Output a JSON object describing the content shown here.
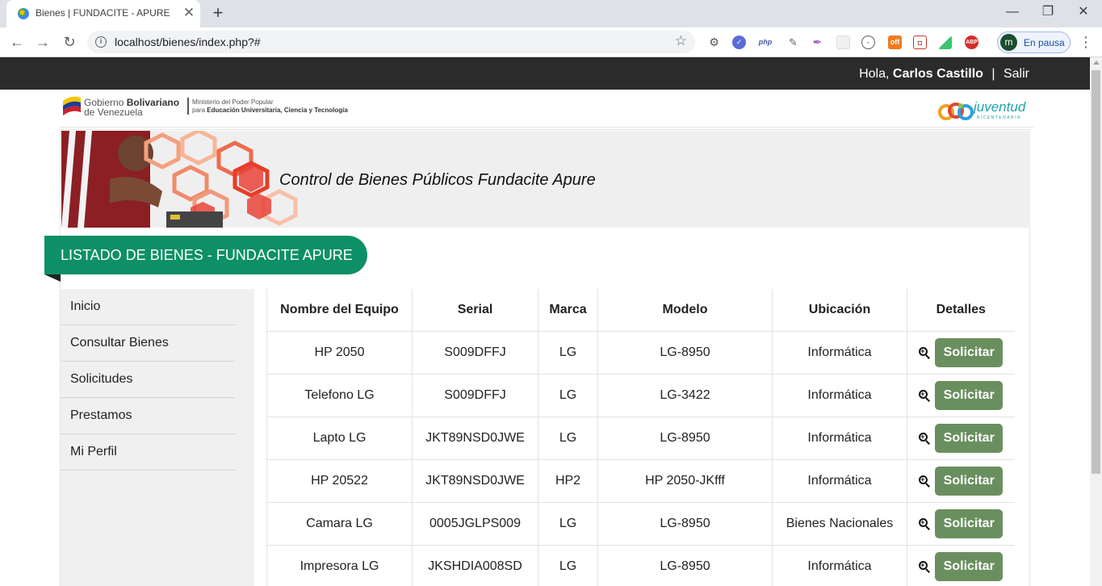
{
  "browser": {
    "tab_title": "Bienes | FUNDACITE - APURE",
    "url": "localhost/bienes/index.php?#",
    "profile_initial": "m",
    "profile_status": "En pausa",
    "extensions": [
      "php",
      "off",
      "ABP"
    ]
  },
  "topbar": {
    "greeting_prefix": "Hola,",
    "user_name": "Carlos Castillo",
    "separator": "|",
    "logout": "Salir"
  },
  "header": {
    "gob_line1_a": "Gobierno",
    "gob_line1_b": "Bolivariano",
    "gob_line2": "de Venezuela",
    "ministry_line1": "Ministerio del Poder Popular",
    "ministry_line2_a": "para",
    "ministry_line2_b": "Educación Universitaria, Ciencia y Tecnología",
    "juventud_logo": "juventud",
    "juventud_sub": "BICENTENARIA"
  },
  "banner": {
    "title": "Control de Bienes Públicos Fundacite Apure"
  },
  "section": {
    "title": "LISTADO DE BIENES - FUNDACITE APURE"
  },
  "sidebar": {
    "items": [
      {
        "label": "Inicio"
      },
      {
        "label": "Consultar Bienes"
      },
      {
        "label": "Solicitudes"
      },
      {
        "label": "Prestamos"
      },
      {
        "label": "Mi Perfil"
      }
    ]
  },
  "table": {
    "headers": [
      "Nombre del Equipo",
      "Serial",
      "Marca",
      "Modelo",
      "Ubicación",
      "Detalles"
    ],
    "action_label": "Solicitar",
    "rows": [
      {
        "nombre": "HP 2050",
        "serial": "S009DFFJ",
        "marca": "LG",
        "modelo": "LG-8950",
        "ubicacion": "Informática"
      },
      {
        "nombre": "Telefono LG",
        "serial": "S009DFFJ",
        "marca": "LG",
        "modelo": "LG-3422",
        "ubicacion": "Informática"
      },
      {
        "nombre": "Lapto LG",
        "serial": "JKT89NSD0JWE",
        "marca": "LG",
        "modelo": "LG-8950",
        "ubicacion": "Informática"
      },
      {
        "nombre": "HP 20522",
        "serial": "JKT89NSD0JWE",
        "marca": "HP2",
        "modelo": "HP 2050-JKfff",
        "ubicacion": "Informática"
      },
      {
        "nombre": "Camara LG",
        "serial": "0005JGLPS009",
        "marca": "LG",
        "modelo": "LG-8950",
        "ubicacion": "Bienes Nacionales"
      },
      {
        "nombre": "Impresora LG",
        "serial": "JKSHDIA008SD",
        "marca": "LG",
        "modelo": "LG-8950",
        "ubicacion": "Informática"
      }
    ]
  },
  "colors": {
    "topbar": "#2b2b2b",
    "section_tab": "#0e9066",
    "action_button": "#6a8f5e",
    "sidebar_bg": "#f0f0f0"
  }
}
